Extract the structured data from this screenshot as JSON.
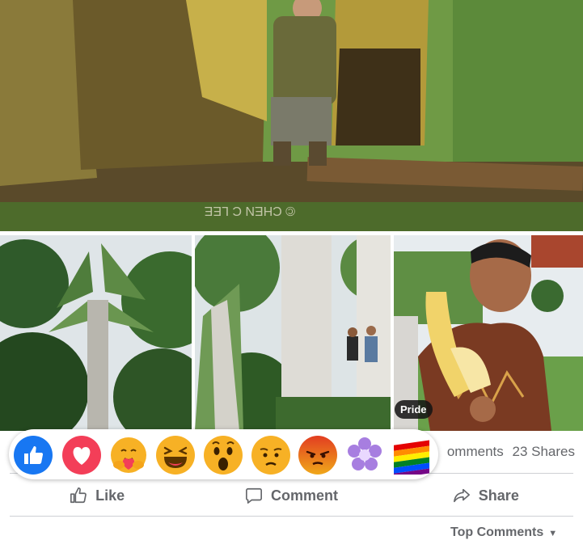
{
  "post": {
    "photos": [
      {
        "name": "main",
        "watermark": "© CHEN C LEE"
      },
      {
        "name": "tree-a"
      },
      {
        "name": "tree-b"
      },
      {
        "name": "banana-man"
      }
    ]
  },
  "stats": {
    "comments_label": "omments",
    "shares_label": "23 Shares"
  },
  "reactions": {
    "items": [
      "like",
      "love",
      "care",
      "haha",
      "wow",
      "sad",
      "angry",
      "flower",
      "pride"
    ],
    "tooltip": "Pride"
  },
  "actions": {
    "like": "Like",
    "comment": "Comment",
    "share": "Share"
  },
  "top_comments": {
    "label": "Top Comments"
  },
  "colors": {
    "like_blue": "#1877f2",
    "love_red": "#f33e58",
    "emoji_yellow": "#f7b125",
    "angry_orange": "#e9710f",
    "text_gray": "#65676b"
  }
}
